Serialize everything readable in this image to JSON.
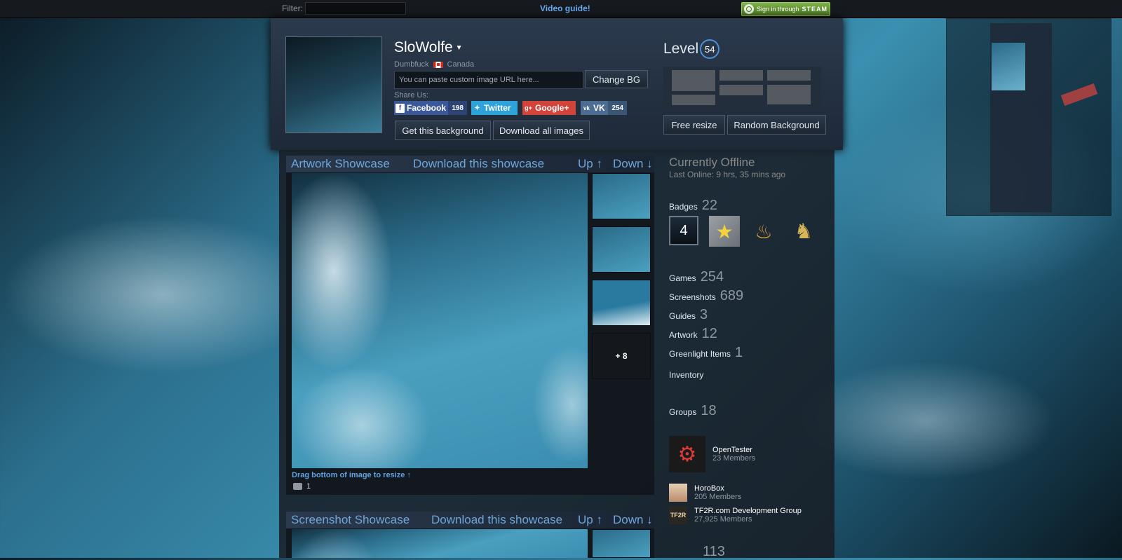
{
  "topbar": {
    "filter_label": "Filter:",
    "video_guide": "Video guide!",
    "signin_prefix": "Sign in through",
    "signin_brand": "STEAM"
  },
  "profile": {
    "name": "SloWolfe",
    "real_name": "Dumbfuck",
    "country": "Canada",
    "url_placeholder": "You can paste custom image URL here...",
    "change_bg": "Change BG",
    "share_label": "Share Us:",
    "share": [
      {
        "label": "Facebook",
        "count": "198",
        "color": "#3b5998",
        "icon": "f"
      },
      {
        "label": "Twitter",
        "count": "",
        "color": "#2ea3d9",
        "icon": "t"
      },
      {
        "label": "Google+",
        "count": "",
        "color": "#d2433a",
        "icon": "g+"
      },
      {
        "label": "VK",
        "count": "254",
        "color": "#4c6c91",
        "icon": "vk"
      }
    ],
    "get_background": "Get this background",
    "download_all": "Download all images",
    "level_label": "Level",
    "level": "54",
    "free_resize": "Free resize",
    "random_background": "Random Background"
  },
  "artwork_showcase": {
    "title": "Artwork Showcase",
    "download": "Download this showcase",
    "up": "Up ↑",
    "down": "Down ↓",
    "more": "+ 8",
    "drag_hint": "Drag bottom of image to resize ↑",
    "comments": "1"
  },
  "screenshot_showcase": {
    "title": "Screenshot Showcase",
    "download": "Download this showcase",
    "up": "Up ↑",
    "down": "Down ↓"
  },
  "status": {
    "title": "Currently Offline",
    "last_online": "Last Online: 9 hrs, 35 mins ago"
  },
  "stats": {
    "badges_label": "Badges",
    "badges_count": "22",
    "games_label": "Games",
    "games_count": "254",
    "screenshots_label": "Screenshots",
    "screenshots_count": "689",
    "guides_label": "Guides",
    "guides_count": "3",
    "artwork_label": "Artwork",
    "artwork_count": "12",
    "greenlight_label": "Greenlight Items",
    "greenlight_count": "1",
    "inventory_label": "Inventory",
    "groups_label": "Groups",
    "groups_count": "18",
    "partial_count": "113"
  },
  "badge_one_number": "4",
  "groups": [
    {
      "name": "OpenTester",
      "members": "23 Members"
    },
    {
      "name": "HoroBox",
      "members": "205 Members"
    },
    {
      "name": "TF2R.com Development Group",
      "members": "27,925 Members"
    }
  ],
  "colors": {
    "accent": "#66a9f1",
    "header_bg": "#2b3a4d",
    "steam_green": "#7fb24a"
  }
}
